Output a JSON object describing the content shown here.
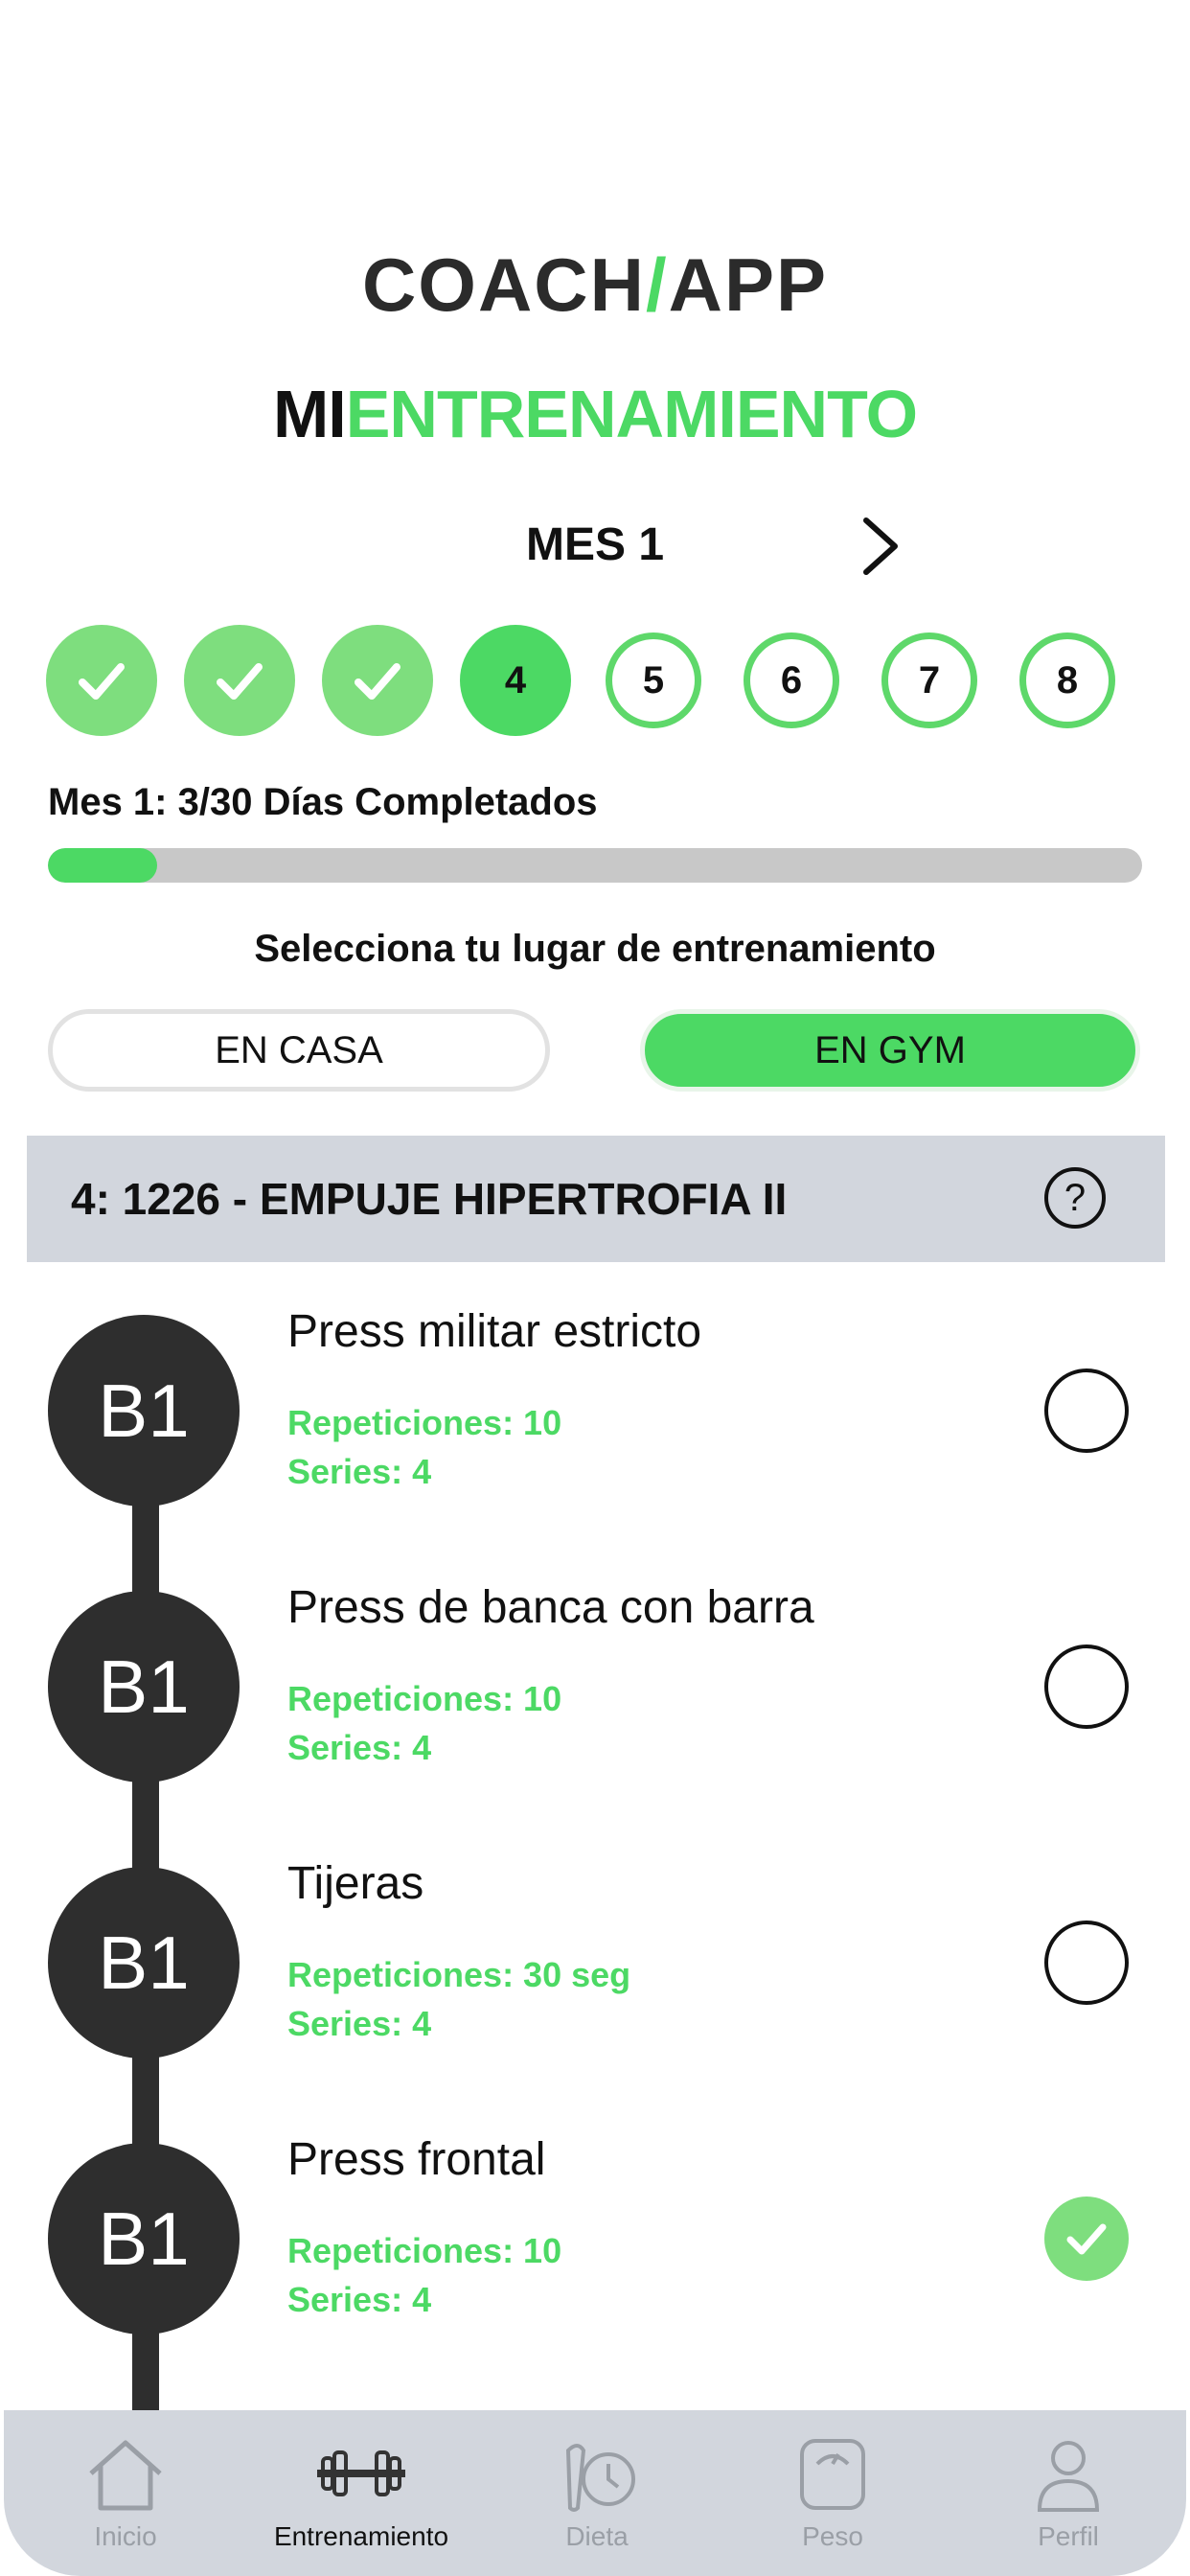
{
  "logo": {
    "left": "COACH",
    "right": "APP"
  },
  "title": {
    "part1": "MI",
    "part2": "ENTRENAMIENTO"
  },
  "month": {
    "label": "MES 1"
  },
  "days": [
    {
      "label": "",
      "state": "done"
    },
    {
      "label": "",
      "state": "done"
    },
    {
      "label": "",
      "state": "done"
    },
    {
      "label": "4",
      "state": "current"
    },
    {
      "label": "5",
      "state": "future"
    },
    {
      "label": "6",
      "state": "future"
    },
    {
      "label": "7",
      "state": "future"
    },
    {
      "label": "8",
      "state": "future"
    }
  ],
  "progress": {
    "text": "Mes 1: 3/30 Días Completados",
    "fraction": 0.1
  },
  "location": {
    "prompt": "Selecciona tu lugar de entrenamiento",
    "home_label": "EN CASA",
    "gym_label": "EN GYM",
    "selected": "gym"
  },
  "workout": {
    "title": "4: 1226 - EMPUJE HIPERTROFIA II",
    "help": "?",
    "exercises": [
      {
        "badge": "B1",
        "name": "Press militar estricto",
        "reps": "Repeticiones: 10",
        "sets": "Series: 4",
        "done": false
      },
      {
        "badge": "B1",
        "name": "Press de banca con barra",
        "reps": "Repeticiones: 10",
        "sets": "Series: 4",
        "done": false
      },
      {
        "badge": "B1",
        "name": "Tijeras",
        "reps": "Repeticiones: 30 seg",
        "sets": "Series: 4",
        "done": false
      },
      {
        "badge": "B1",
        "name": "Press frontal",
        "reps": "Repeticiones: 10",
        "sets": "Series: 4",
        "done": true
      }
    ]
  },
  "tabs": [
    {
      "label": "Inicio",
      "icon": "home-icon",
      "active": false
    },
    {
      "label": "Entrenamiento",
      "icon": "dumbbell-icon",
      "active": true
    },
    {
      "label": "Dieta",
      "icon": "diet-clock-icon",
      "active": false
    },
    {
      "label": "Peso",
      "icon": "scale-icon",
      "active": false
    },
    {
      "label": "Perfil",
      "icon": "user-icon",
      "active": false
    }
  ],
  "colors": {
    "accent": "#4cd964",
    "done": "#7ede7e",
    "dark": "#2e2e2e",
    "tabbar": "#d2d6dd"
  }
}
